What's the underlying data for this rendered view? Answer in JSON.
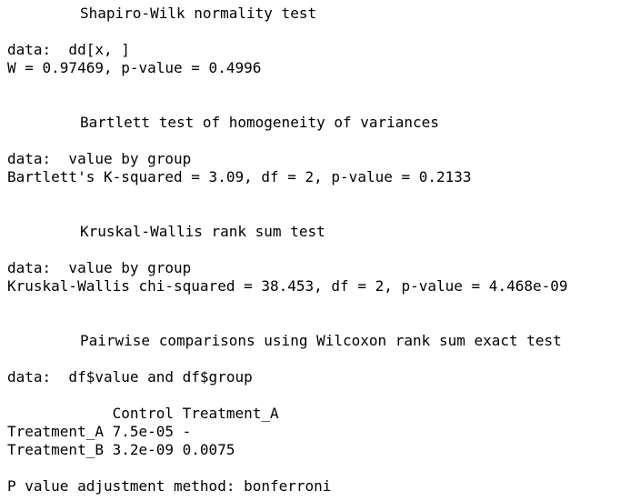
{
  "sections": [
    {
      "title": "Shapiro-Wilk normality test",
      "data_line": "data:  dd[x, ]",
      "result_line": "W = 0.97469, p-value = 0.4996"
    },
    {
      "title": "Bartlett test of homogeneity of variances",
      "data_line": "data:  value by group",
      "result_line": "Bartlett's K-squared = 3.09, df = 2, p-value = 0.2133"
    },
    {
      "title": "Kruskal-Wallis rank sum test",
      "data_line": "data:  value by group",
      "result_line": "Kruskal-Wallis chi-squared = 38.453, df = 2, p-value = 4.468e-09"
    },
    {
      "title": "Pairwise comparisons using Wilcoxon rank sum exact test",
      "data_line": "data:  df$value and df$group"
    }
  ],
  "pairwise_table": {
    "header": "            Control Treatment_A",
    "rows": [
      "Treatment_A 7.5e-05 -",
      "Treatment_B 3.2e-09 0.0075"
    ]
  },
  "adjustment_line": "P value adjustment method: bonferroni"
}
